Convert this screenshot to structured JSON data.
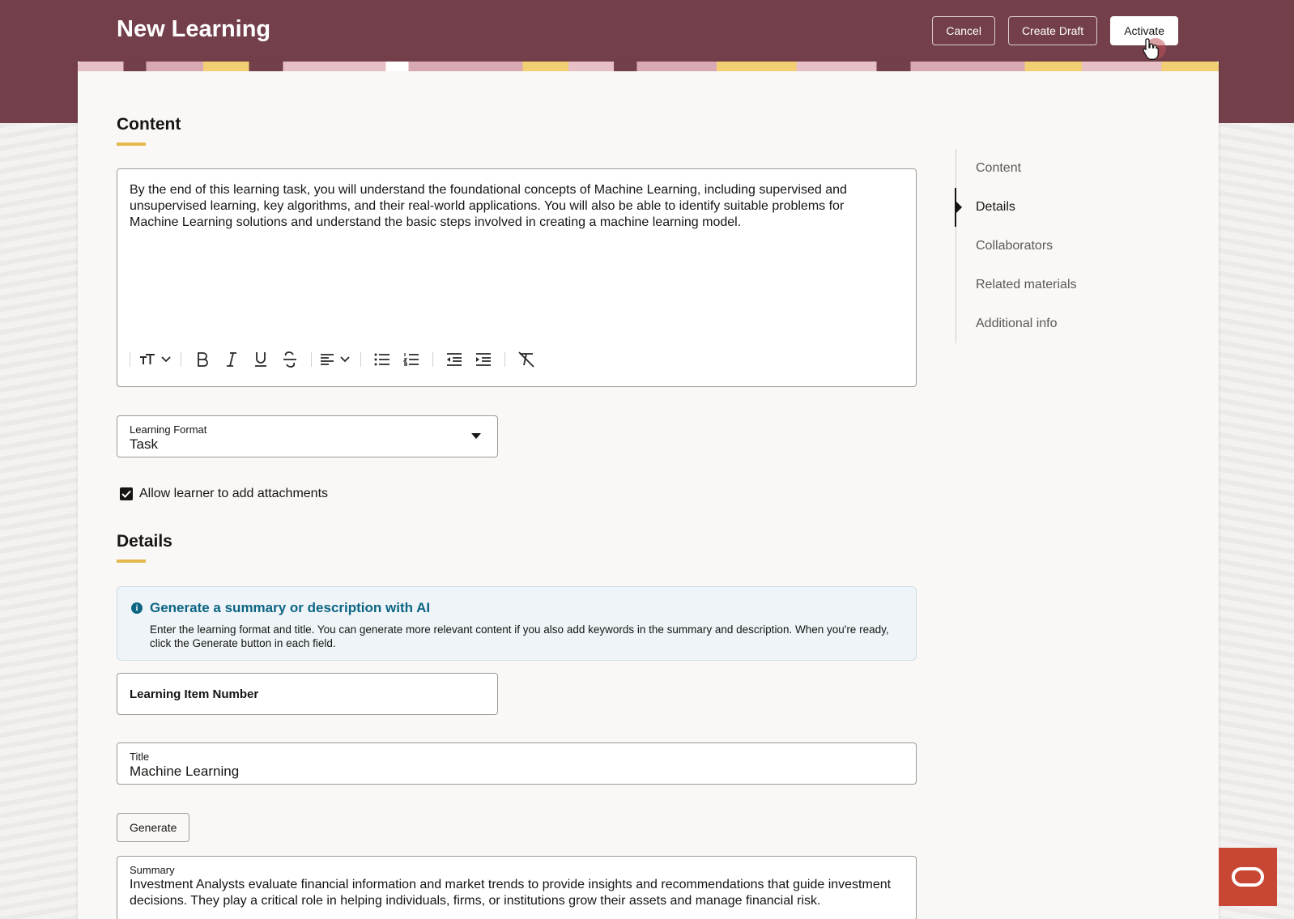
{
  "header": {
    "title": "New Learning",
    "cancel_label": "Cancel",
    "draft_label": "Create Draft",
    "activate_label": "Activate"
  },
  "content_section": {
    "title": "Content",
    "editor_text": "By the end of this learning task, you will understand the foundational concepts of Machine Learning, including supervised and unsupervised learning, key algorithms, and their real-world applications. You will also be able to identify suitable problems for Machine Learning solutions and understand the basic steps involved in creating a machine learning model.",
    "toolbar_icons": [
      "text-size-icon",
      "chevron-down-icon",
      "bold-icon",
      "italic-icon",
      "underline-icon",
      "strikethrough-icon",
      "align-left-icon",
      "chevron-down-icon",
      "bulleted-list-icon",
      "numbered-list-icon",
      "outdent-icon",
      "indent-icon",
      "clear-format-icon"
    ],
    "learning_format": {
      "label": "Learning Format",
      "value": "Task"
    },
    "attachments_checkbox": {
      "label": "Allow learner to add attachments",
      "checked": true
    }
  },
  "details_section": {
    "title": "Details",
    "ai_banner": {
      "title": "Generate a summary or description with AI",
      "body": "Enter the learning format and title. You can generate more relevant content if you also add keywords in the summary and description. When you're ready, click the Generate button in each field."
    },
    "item_number": {
      "label": "Learning Item Number",
      "value": ""
    },
    "title_field": {
      "label": "Title",
      "value": "Machine Learning"
    },
    "generate_label": "Generate",
    "summary": {
      "label": "Summary",
      "value": "Investment Analysts evaluate financial information and market trends to provide insights and recommendations that guide investment decisions. They play a critical role in helping individuals, firms, or institutions grow their assets and manage financial risk."
    }
  },
  "toc": {
    "items": [
      {
        "label": "Content",
        "active": false
      },
      {
        "label": "Details",
        "active": true
      },
      {
        "label": "Collaborators",
        "active": false
      },
      {
        "label": "Related materials",
        "active": false
      },
      {
        "label": "Additional info",
        "active": false
      }
    ]
  },
  "colors": {
    "header_bg": "#733f4a",
    "accent_underline": "#e6b94f",
    "info_title": "#0d6584",
    "launcher": "#c74634"
  }
}
